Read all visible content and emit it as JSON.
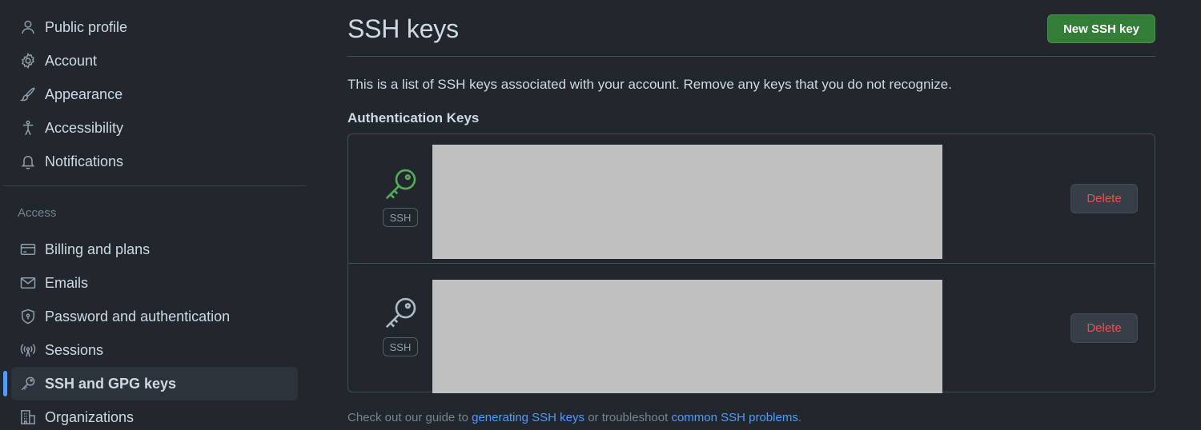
{
  "sidebar": {
    "items": [
      {
        "label": "Public profile",
        "icon": "person-icon"
      },
      {
        "label": "Account",
        "icon": "gear-icon"
      },
      {
        "label": "Appearance",
        "icon": "paintbrush-icon"
      },
      {
        "label": "Accessibility",
        "icon": "accessibility-icon"
      },
      {
        "label": "Notifications",
        "icon": "bell-icon"
      }
    ],
    "access_heading": "Access",
    "access_items": [
      {
        "label": "Billing and plans",
        "icon": "credit-card-icon"
      },
      {
        "label": "Emails",
        "icon": "mail-icon"
      },
      {
        "label": "Password and authentication",
        "icon": "shield-lock-icon"
      },
      {
        "label": "Sessions",
        "icon": "broadcast-icon"
      },
      {
        "label": "SSH and GPG keys",
        "icon": "key-icon",
        "selected": true
      },
      {
        "label": "Organizations",
        "icon": "organization-icon"
      }
    ]
  },
  "main": {
    "title": "SSH keys",
    "new_key_button": "New SSH key",
    "description": "This is a list of SSH keys associated with your account. Remove any keys that you do not recognize.",
    "subhead": "Authentication Keys",
    "keys": [
      {
        "type_label": "SSH",
        "icon": "key-icon",
        "status_color": "#57ab5a",
        "delete_label": "Delete"
      },
      {
        "type_label": "SSH",
        "icon": "key-icon",
        "status_color": "#adbac7",
        "delete_label": "Delete"
      }
    ],
    "footer": {
      "prefix": "Check out our guide to ",
      "link1": "generating SSH keys",
      "middle": " or troubleshoot ",
      "link2": "common SSH problems",
      "suffix": "."
    }
  },
  "colors": {
    "background": "#22272e",
    "accent": "#539bf5",
    "primary_button": "#347d39",
    "danger": "#e5534b"
  }
}
